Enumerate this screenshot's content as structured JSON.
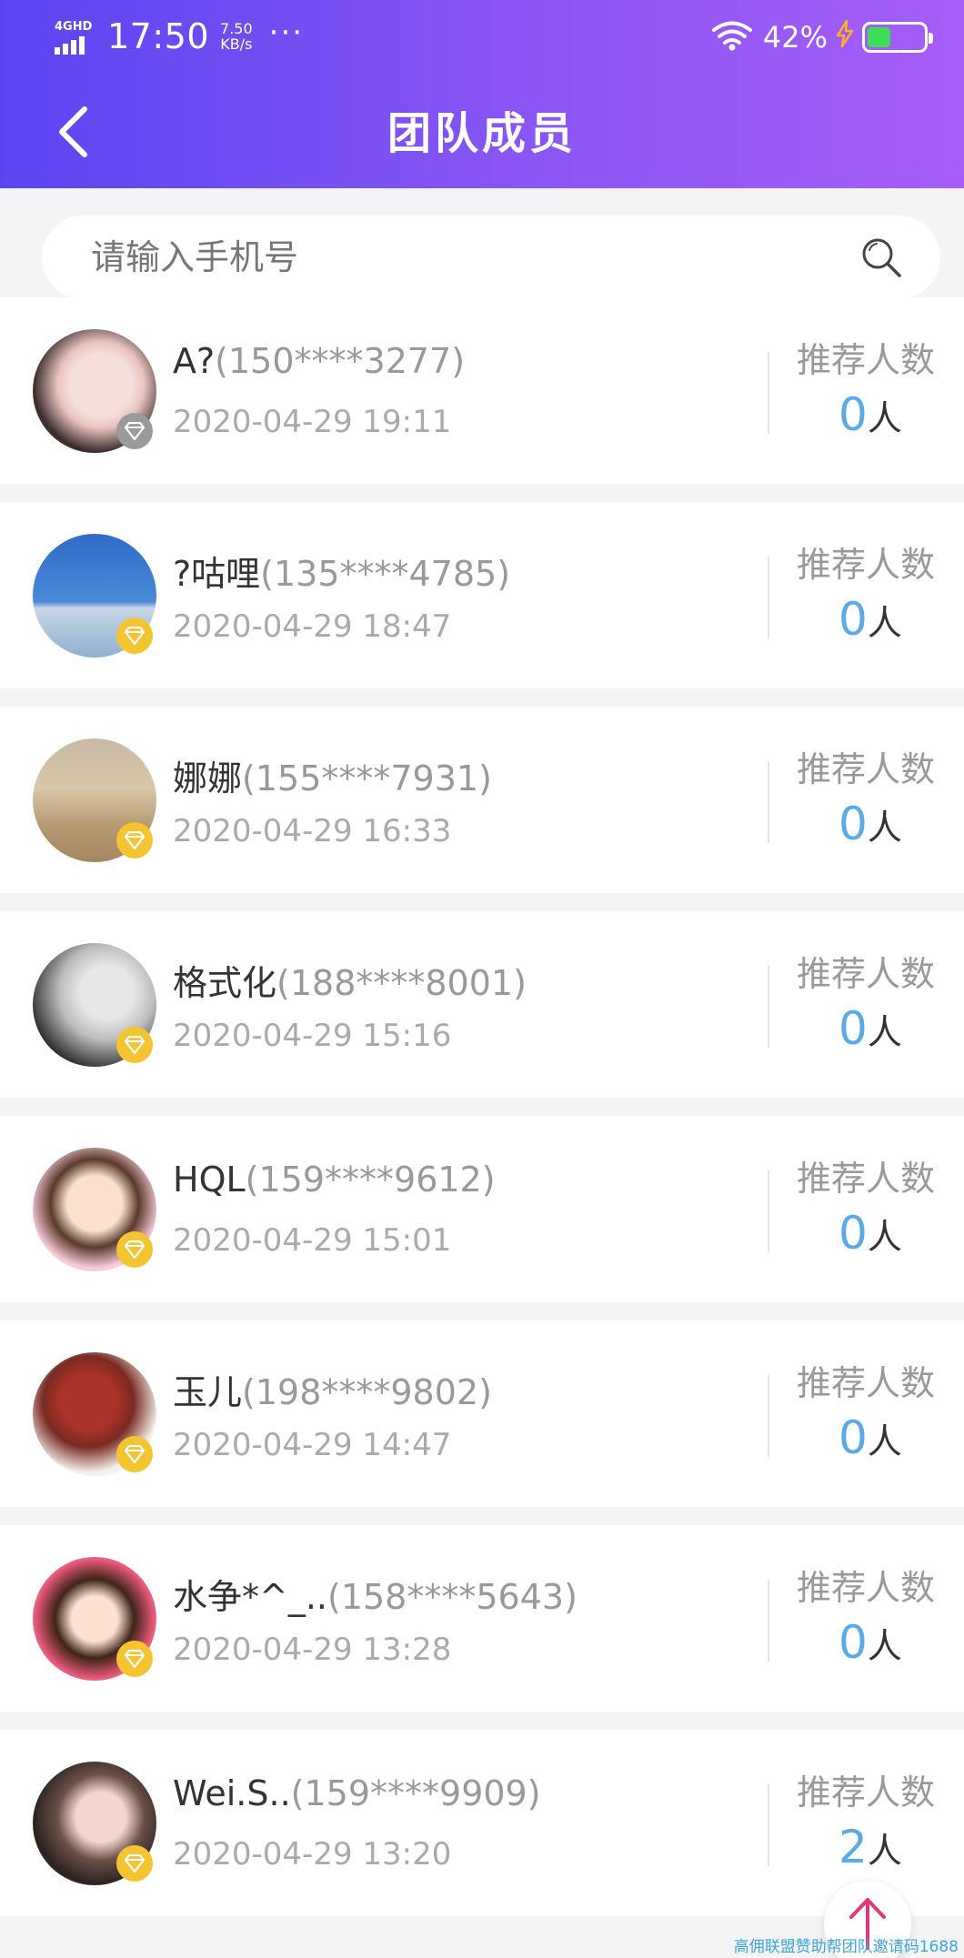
{
  "status_bar": {
    "network": "4GHD",
    "time": "17:50",
    "speed_value": "7.50",
    "speed_unit": "KB/s",
    "more": "···",
    "battery_percent": "42%",
    "battery_level": 0.42,
    "icons": [
      "signal-icon",
      "wifi-icon",
      "charging-icon",
      "battery-icon"
    ]
  },
  "header": {
    "title": "团队成员",
    "back_icon": "chevron-left-icon"
  },
  "search": {
    "placeholder": "请输入手机号",
    "value": "",
    "icon": "search-icon"
  },
  "members": [
    {
      "name": "A?",
      "phone": "(150****3277)",
      "time": "2020-04-29 19:11",
      "ref_label": "推荐人数",
      "ref_count": "0",
      "ref_unit": "人",
      "badge": "silver"
    },
    {
      "name": "?咕哩",
      "phone": "(135****4785)",
      "time": "2020-04-29 18:47",
      "ref_label": "推荐人数",
      "ref_count": "0",
      "ref_unit": "人",
      "badge": "gold"
    },
    {
      "name": "娜娜",
      "phone": "(155****7931)",
      "time": "2020-04-29 16:33",
      "ref_label": "推荐人数",
      "ref_count": "0",
      "ref_unit": "人",
      "badge": "gold"
    },
    {
      "name": "格式化",
      "phone": "(188****8001)",
      "time": "2020-04-29 15:16",
      "ref_label": "推荐人数",
      "ref_count": "0",
      "ref_unit": "人",
      "badge": "gold"
    },
    {
      "name": "HQL",
      "phone": "(159****9612)",
      "time": "2020-04-29 15:01",
      "ref_label": "推荐人数",
      "ref_count": "0",
      "ref_unit": "人",
      "badge": "gold"
    },
    {
      "name": "玉儿",
      "phone": "(198****9802)",
      "time": "2020-04-29 14:47",
      "ref_label": "推荐人数",
      "ref_count": "0",
      "ref_unit": "人",
      "badge": "gold"
    },
    {
      "name": "水争*^_..",
      "phone": "(158****5643)",
      "time": "2020-04-29 13:28",
      "ref_label": "推荐人数",
      "ref_count": "0",
      "ref_unit": "人",
      "badge": "gold"
    },
    {
      "name": "Wei.S..",
      "phone": "(159****9909)",
      "time": "2020-04-29 13:20",
      "ref_label": "推荐人数",
      "ref_count": "2",
      "ref_unit": "人",
      "badge": "gold"
    }
  ],
  "fab": {
    "icon": "arrow-up-icon"
  },
  "watermark": "高佣联盟赞助帮团队邀请码1688",
  "colors": {
    "header_gradient_start": "#5b45f2",
    "header_gradient_end": "#a65ef7",
    "count_blue": "#5aa9e8",
    "gold_badge": "#f5c431",
    "silver_badge": "#9a9a9a",
    "fab_arrow": "#e0367a"
  }
}
